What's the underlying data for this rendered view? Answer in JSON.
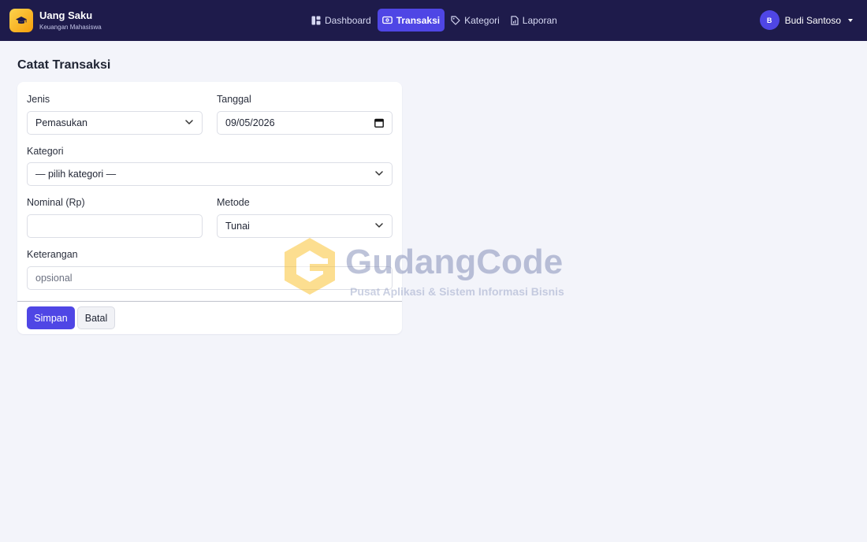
{
  "brand": {
    "title": "Uang Saku",
    "subtitle": "Keuangan Mahasiswa",
    "icon": "graduation-cap-icon",
    "accent": "#f59e0b"
  },
  "nav": {
    "items": [
      {
        "label": "Dashboard",
        "icon": "dashboard-icon",
        "active": false
      },
      {
        "label": "Transaksi",
        "icon": "wallet-icon",
        "active": true
      },
      {
        "label": "Kategori",
        "icon": "tag-icon",
        "active": false
      },
      {
        "label": "Laporan",
        "icon": "report-icon",
        "active": false
      }
    ]
  },
  "user": {
    "initial": "B",
    "name": "Budi Santoso"
  },
  "page": {
    "title": "Catat Transaksi"
  },
  "form": {
    "jenis": {
      "label": "Jenis",
      "value": "Pemasukan"
    },
    "tanggal": {
      "label": "Tanggal",
      "value": "09/05/2026"
    },
    "kategori": {
      "label": "Kategori",
      "value": "— pilih kategori —"
    },
    "nominal": {
      "label": "Nominal (Rp)",
      "value": ""
    },
    "metode": {
      "label": "Metode",
      "value": "Tunai"
    },
    "keterangan": {
      "label": "Keterangan",
      "placeholder": "opsional",
      "value": ""
    },
    "save_label": "Simpan",
    "cancel_label": "Batal"
  },
  "watermark": {
    "title": "GudangCode",
    "subtitle": "Pusat Aplikasi & Sistem Informasi Bisnis"
  },
  "colors": {
    "navbar": "#1e1b4b",
    "primary": "#4f46e5",
    "background": "#f3f4fa"
  }
}
